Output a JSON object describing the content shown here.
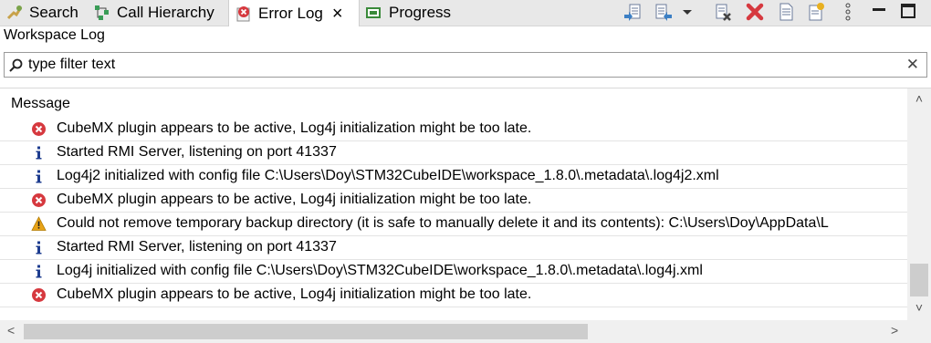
{
  "tabs": [
    {
      "label": "Search",
      "icon": "search-icon"
    },
    {
      "label": "Call Hierarchy",
      "icon": "call-hierarchy-icon"
    },
    {
      "label": "Error Log",
      "icon": "error-log-icon",
      "active": true
    },
    {
      "label": "Progress",
      "icon": "progress-icon"
    }
  ],
  "toolbar": [
    "export-log-icon",
    "import-log-icon",
    "dropdown-icon",
    "clear-log-icon",
    "delete-log-icon",
    "open-log-icon",
    "restore-log-icon",
    "view-menu-icon",
    "minimize-icon",
    "maximize-icon"
  ],
  "view_label": "Workspace Log",
  "filter": {
    "placeholder": "type filter text"
  },
  "column_header": "Message",
  "rows": [
    {
      "severity": "error",
      "message": "CubeMX plugin appears to be active, Log4j initialization might be too late."
    },
    {
      "severity": "info",
      "message": "Started RMI Server, listening on port 41337"
    },
    {
      "severity": "info",
      "message": "Log4j2 initialized with config file C:\\Users\\Doy\\STM32CubeIDE\\workspace_1.8.0\\.metadata\\.log4j2.xml"
    },
    {
      "severity": "error",
      "message": "CubeMX plugin appears to be active, Log4j initialization might be too late."
    },
    {
      "severity": "warning",
      "message": "Could not remove temporary backup directory (it is safe to manually delete it and its contents): C:\\Users\\Doy\\AppData\\L"
    },
    {
      "severity": "info",
      "message": "Started RMI Server, listening on port 41337"
    },
    {
      "severity": "info",
      "message": "Log4j initialized with config file C:\\Users\\Doy\\STM32CubeIDE\\workspace_1.8.0\\.metadata\\.log4j.xml"
    },
    {
      "severity": "error",
      "message": "CubeMX plugin appears to be active, Log4j initialization might be too late."
    }
  ],
  "colors": {
    "error": "#d6393f",
    "info": "#1d3c8f",
    "warning": "#e8a317",
    "tabbar": "#e8e8e8"
  }
}
